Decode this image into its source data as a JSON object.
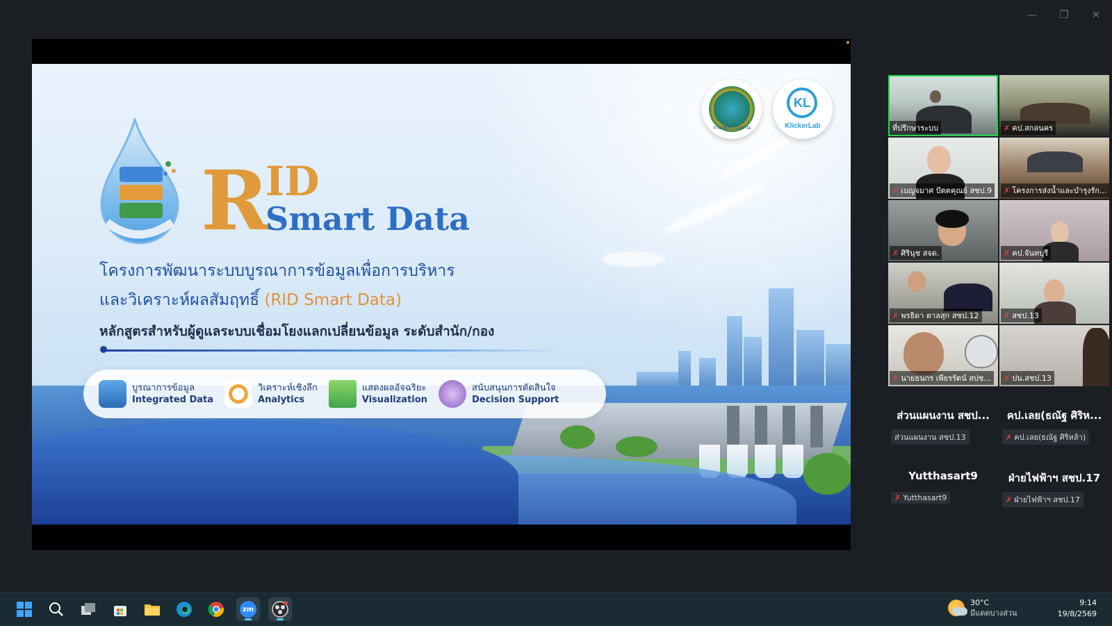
{
  "window_controls": {
    "minimize": "—",
    "restore": "❐",
    "close": "✕"
  },
  "slide": {
    "logo_rid_text": "กรมชลประทาน",
    "logo_kl_mark": "KL",
    "logo_kl_text": "KlickerLab",
    "drop_label": "RID SMART DATA",
    "title_r": "R",
    "title_id": "ID",
    "title_smart": "Smart Data",
    "subtitle_line1": "โครงการพัฒนาระบบบูรณาการข้อมูลเพื่อการบริหาร",
    "subtitle_line2": "และวิเคราะห์ผลสัมฤทธิ์",
    "subtitle_line2_highlight": "(RID Smart Data)",
    "course_line": "หลักสูตรสำหรับผู้ดูแลระบบเชื่อมโยงแลกเปลี่ยนข้อมูล ระดับสำนัก/กอง",
    "features": [
      {
        "thai": "บูรณาการข้อมูล",
        "en": "Integrated Data",
        "icon": "database-icon"
      },
      {
        "thai": "วิเคราะห์เชิงลึก",
        "en": "Analytics",
        "icon": "magnifier-chart-icon"
      },
      {
        "thai": "แสดงผลอัจฉริยะ",
        "en": "Visualization",
        "icon": "monitor-chart-icon"
      },
      {
        "thai": "สนับสนุนการตัดสินใจ",
        "en": "Decision Support",
        "icon": "pie-chart-icon"
      }
    ]
  },
  "participants": {
    "video_tiles": [
      {
        "name": "ที่ปรึกษาระบบ",
        "muted": false,
        "active": true
      },
      {
        "name": "คป.สกลนคร",
        "muted": true
      },
      {
        "name": "เบญจมาศ ปัตตคุณย์ สชป.9",
        "muted": true
      },
      {
        "name": "โครงการส่งน้ำและบำรุงรัก...",
        "muted": true
      },
      {
        "name": "ศิรินุช สจด.",
        "muted": true
      },
      {
        "name": "คป.จันทบุรี",
        "muted": true
      },
      {
        "name": "พรธิดา ตาลสุก สชป.12",
        "muted": true
      },
      {
        "name": "สชป.13",
        "muted": true
      },
      {
        "name": "นายธนกร เพียรรัตน์ สปช...",
        "muted": true
      },
      {
        "name": "ปน.สชป.13",
        "muted": true
      }
    ],
    "audio_tiles": [
      {
        "display": "ส่วนแผนงาน สชป...",
        "name": "ส่วนแผนงาน สชป.13",
        "muted": false
      },
      {
        "display": "คป.เลย(ธณัฐ ศิริห...",
        "name": "คป.เลย(ธณัฐ ศิริหล้า)",
        "muted": true
      },
      {
        "display": "Yutthasart9",
        "name": "Yutthasart9",
        "muted": true
      },
      {
        "display": "ฝ่ายไฟฟ้าฯ สชป.17",
        "name": "ฝ่ายไฟฟ้าฯ สชป.17",
        "muted": true
      }
    ]
  },
  "taskbar": {
    "apps": [
      "start",
      "search",
      "task-view",
      "store",
      "file-explorer",
      "edge",
      "chrome",
      "zoom",
      "obs"
    ],
    "zoom_label": "zm",
    "weather_temp": "30°C",
    "weather_desc": "มีแดดบางส่วน",
    "time": "9:14",
    "date": "19/8/2569"
  }
}
